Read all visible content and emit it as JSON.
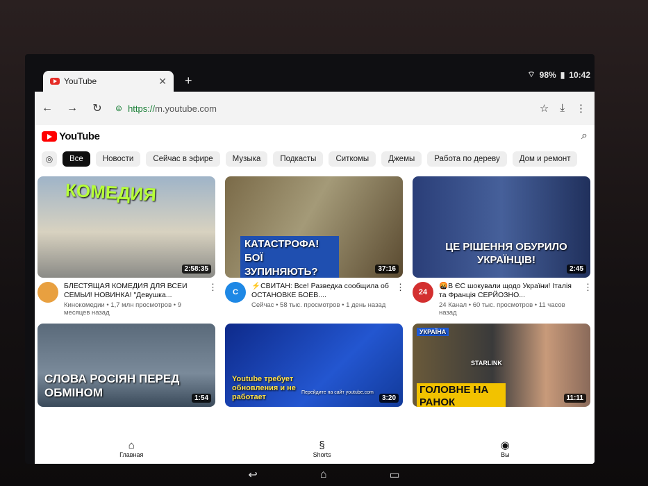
{
  "status": {
    "battery": "98%",
    "time": "10:42"
  },
  "tab": {
    "title": "YouTube",
    "close": "✕",
    "new_tab": "+"
  },
  "address": {
    "scheme": "https://",
    "host": "m.youtube.com"
  },
  "youtube": {
    "logo": "YouTube",
    "chips": [
      "Все",
      "Новости",
      "Сейчас в эфире",
      "Музыка",
      "Подкасты",
      "Ситкомы",
      "Джемы",
      "Работа по дереву",
      "Дом и ремонт"
    ],
    "videos": [
      {
        "thumb_text": "КОМЕДИЯ",
        "duration": "2:58:35",
        "title": "БЛЕСТЯЩАЯ КОМЕДИЯ ДЛЯ ВСЕИ СЕМЬИ! НОВИНКА! \"Девушка...",
        "meta": "Кинокомедии • 1,7 млн просмотров • 9 месяцев назад",
        "avatar": "",
        "color": "#c8d6b0"
      },
      {
        "thumb_text": "КАТАСТРОФА! БОЇ ЗУПИНЯЮТЬ?",
        "duration": "37:16",
        "title": "⚡СВИТАН: Все! Разведка сообщила об ОСТАНОВКЕ БОЕВ....",
        "meta": "Сейчас • 58 тыс. просмотров • 1 день назад",
        "avatar": "С",
        "color": "#8a7a5a"
      },
      {
        "thumb_text": "ЦЕ РІШЕННЯ ОБУРИЛО УКРАЇНЦІВ!",
        "duration": "2:45",
        "title": "🤬В ЄС шокували щодо України! Італія та Франція СЕРЙОЗНО...",
        "meta": "24 Канал • 60 тыс. просмотров • 11 часов назад",
        "avatar": "24",
        "color": "#2a3a6a"
      },
      {
        "thumb_text": "СЛОВА РОСІЯН ПЕРЕД ОБМІНОМ",
        "duration": "1:54",
        "title": "",
        "meta": "",
        "avatar": "",
        "color": "#4a5a6a"
      },
      {
        "thumb_text": "Youtube требует обновления и не работает",
        "duration": "3:20",
        "title": "",
        "meta": "",
        "avatar": "",
        "color": "#1a3a9a"
      },
      {
        "thumb_text": "ГОЛОВНЕ НА РАНОК",
        "duration": "11:11",
        "title": "",
        "meta": "",
        "avatar": "",
        "color": "#5a4a3a"
      }
    ],
    "extra_thumb_text": {
      "v1": "Перейдите на сайт youtube.com",
      "v2": "STARLINK",
      "v3": "УКРАЇНА"
    },
    "nav": [
      {
        "label": "Главная",
        "icon": "⌂"
      },
      {
        "label": "Shorts",
        "icon": "§"
      },
      {
        "label": "Вы",
        "icon": "◉"
      }
    ]
  },
  "colors": {
    "brand": "#ff0000",
    "chip_active": "#0f0f0f"
  }
}
